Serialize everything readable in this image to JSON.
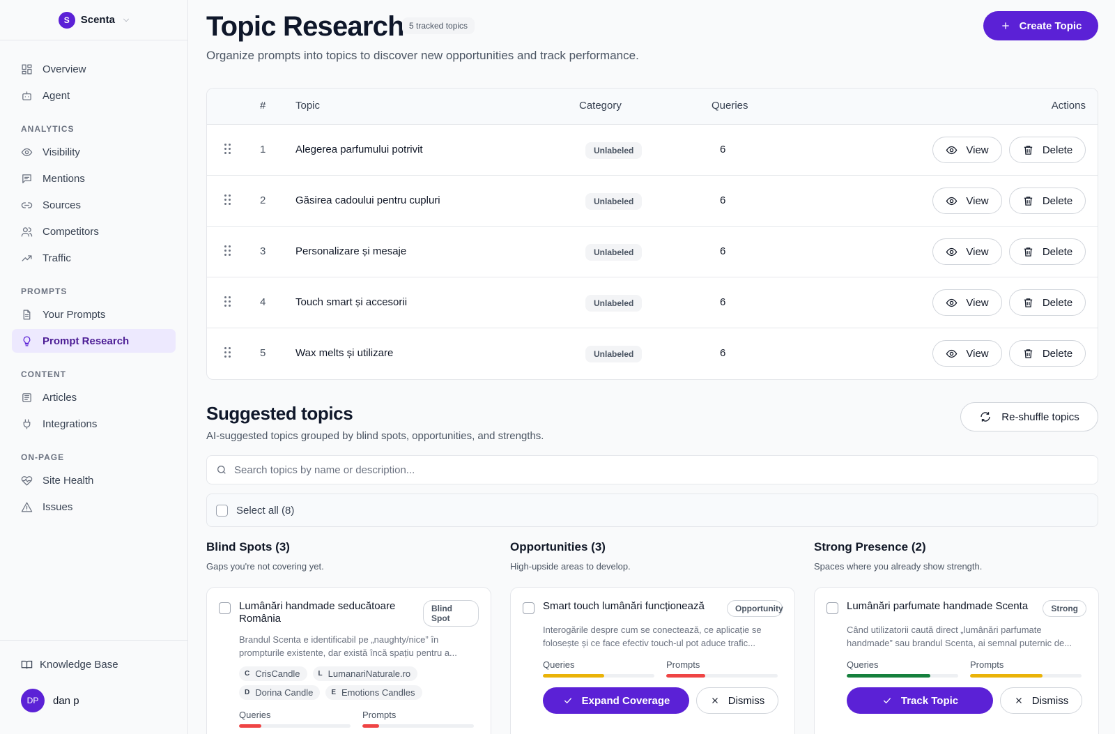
{
  "org": {
    "initial": "S",
    "name": "Scenta"
  },
  "nav": {
    "top": [
      {
        "label": "Overview",
        "icon": "grid-icon"
      },
      {
        "label": "Agent",
        "icon": "bot-icon"
      }
    ],
    "sections": [
      {
        "title": "ANALYTICS",
        "items": [
          {
            "label": "Visibility",
            "icon": "eye-icon"
          },
          {
            "label": "Mentions",
            "icon": "message-icon"
          },
          {
            "label": "Sources",
            "icon": "link-icon"
          },
          {
            "label": "Competitors",
            "icon": "users-icon"
          },
          {
            "label": "Traffic",
            "icon": "trend-icon"
          }
        ]
      },
      {
        "title": "PROMPTS",
        "items": [
          {
            "label": "Your Prompts",
            "icon": "file-icon"
          },
          {
            "label": "Prompt Research",
            "icon": "bulb-icon",
            "active": true
          }
        ]
      },
      {
        "title": "CONTENT",
        "items": [
          {
            "label": "Articles",
            "icon": "newspaper-icon"
          },
          {
            "label": "Integrations",
            "icon": "plug-icon"
          }
        ]
      },
      {
        "title": "ON-PAGE",
        "items": [
          {
            "label": "Site Health",
            "icon": "heart-pulse-icon"
          },
          {
            "label": "Issues",
            "icon": "warning-icon"
          }
        ]
      }
    ]
  },
  "footer": {
    "knowledge_base": "Knowledge Base",
    "user_initials": "DP",
    "user_name": "dan p"
  },
  "header": {
    "title": "Topic Research",
    "tracked_badge": "5 tracked topics",
    "subtitle": "Organize prompts into topics to discover new opportunities and track performance.",
    "create_label": "Create Topic"
  },
  "table": {
    "columns": {
      "num": "#",
      "topic": "Topic",
      "category": "Category",
      "queries": "Queries",
      "actions": "Actions"
    },
    "view_label": "View",
    "delete_label": "Delete",
    "rows": [
      {
        "num": "1",
        "topic": "Alegerea parfumului potrivit",
        "category": "Unlabeled",
        "queries": "6"
      },
      {
        "num": "2",
        "topic": "Găsirea cadoului pentru cupluri",
        "category": "Unlabeled",
        "queries": "6"
      },
      {
        "num": "3",
        "topic": "Personalizare și mesaje",
        "category": "Unlabeled",
        "queries": "6"
      },
      {
        "num": "4",
        "topic": "Touch smart și accesorii",
        "category": "Unlabeled",
        "queries": "6"
      },
      {
        "num": "5",
        "topic": "Wax melts și utilizare",
        "category": "Unlabeled",
        "queries": "6"
      }
    ]
  },
  "suggested": {
    "title": "Suggested topics",
    "subtitle": "AI-suggested topics grouped by blind spots, opportunities, and strengths.",
    "reshuffle_label": "Re-shuffle topics",
    "search_placeholder": "Search topics by name or description...",
    "select_all": "Select all (8)",
    "queries_label": "Queries",
    "prompts_label": "Prompts",
    "dismiss_label": "Dismiss",
    "columns": [
      {
        "title": "Blind Spots (3)",
        "subtitle": "Gaps you're not covering yet.",
        "card": {
          "title": "Lumânări handmade seducătoare România",
          "badge": "Blind Spot",
          "desc": "Brandul Scenta e identificabil pe „naughty/nice” în prompturile existente, dar există încă spațiu pentru a...",
          "chips": [
            {
              "initial": "C",
              "name": "CrisCandle"
            },
            {
              "initial": "L",
              "name": "LumanariNaturale.ro"
            },
            {
              "initial": "D",
              "name": "Dorina Candle"
            },
            {
              "initial": "E",
              "name": "Emotions Candles"
            }
          ],
          "queries_fill": 0.2,
          "prompts_fill": 0.15,
          "queries_color": "#ef4444",
          "prompts_color": "#ef4444",
          "action": ""
        }
      },
      {
        "title": "Opportunities (3)",
        "subtitle": "High-upside areas to develop.",
        "card": {
          "title": "Smart touch lumânări funcționează",
          "badge": "Opportunity",
          "desc": "Interogările despre cum se conectează, ce aplicație se folosește și ce face efectiv touch-ul pot aduce trafic...",
          "chips": [],
          "queries_fill": 0.55,
          "prompts_fill": 0.35,
          "queries_color": "#eab308",
          "prompts_color": "#ef4444",
          "action": "Expand Coverage"
        }
      },
      {
        "title": "Strong Presence (2)",
        "subtitle": "Spaces where you already show strength.",
        "card": {
          "title": "Lumânări parfumate handmade Scenta",
          "badge": "Strong",
          "desc": "Când utilizatorii caută direct „lumânări parfumate handmade” sau brandul Scenta, ai semnal puternic de...",
          "chips": [],
          "queries_fill": 0.75,
          "prompts_fill": 0.65,
          "queries_color": "#15803d",
          "prompts_color": "#eab308",
          "action": "Track Topic"
        }
      }
    ]
  }
}
